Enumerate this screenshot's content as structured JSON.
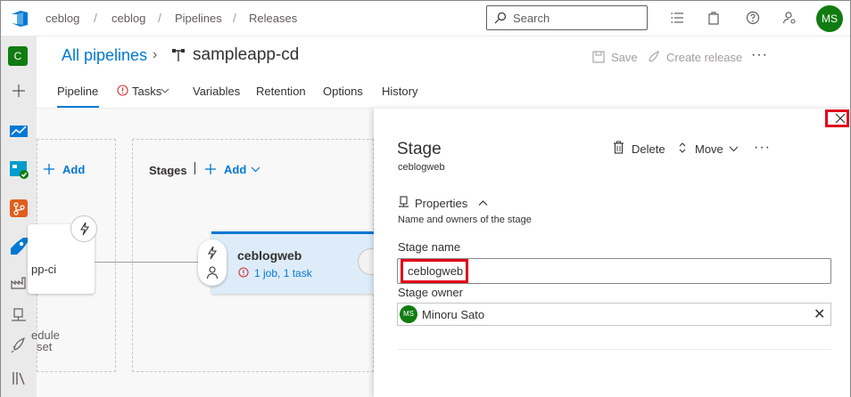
{
  "breadcrumb": {
    "org": "ceblog",
    "project": "ceblog",
    "section": "Pipelines",
    "page": "Releases",
    "separator": "/"
  },
  "search": {
    "placeholder": "Search"
  },
  "user": {
    "initials": "MS"
  },
  "rail": {
    "project_initial": "C"
  },
  "header": {
    "all_pipelines": "All pipelines",
    "chevron": "›",
    "pipeline_name": "sampleapp-cd",
    "save_label": "Save",
    "create_release_label": "Create release",
    "more_label": "···"
  },
  "tabs": [
    {
      "label": "Pipeline",
      "active": true
    },
    {
      "label": "Tasks",
      "active": false
    },
    {
      "label": "Variables",
      "active": false
    },
    {
      "label": "Retention",
      "active": false
    },
    {
      "label": "Options",
      "active": false
    },
    {
      "label": "History",
      "active": false
    }
  ],
  "canvas": {
    "artifacts_add_label": "Add",
    "artifact_name": "pp-ci",
    "schedule_line1": "edule",
    "schedule_line2": "set",
    "stages_label": "Stages",
    "stages_add_label": "Add",
    "stage_card": {
      "name": "ceblogweb",
      "jobs": "1 job, 1 task"
    }
  },
  "panel": {
    "title": "Stage",
    "subtitle": "ceblogweb",
    "delete_label": "Delete",
    "move_label": "Move",
    "more_label": "···",
    "properties_label": "Properties",
    "properties_desc": "Name and owners of the stage",
    "stage_name_label": "Stage name",
    "stage_name_value": "ceblogweb",
    "stage_owner_label": "Stage owner",
    "owner_initials": "MS",
    "owner_name": "Minoru Sato",
    "clear_label": "✕"
  },
  "colors": {
    "accent": "#0078d4",
    "avatar": "#107c10",
    "highlight": "#e0001b",
    "stage_card_bg": "#deecf9",
    "warning": "#d13438"
  }
}
